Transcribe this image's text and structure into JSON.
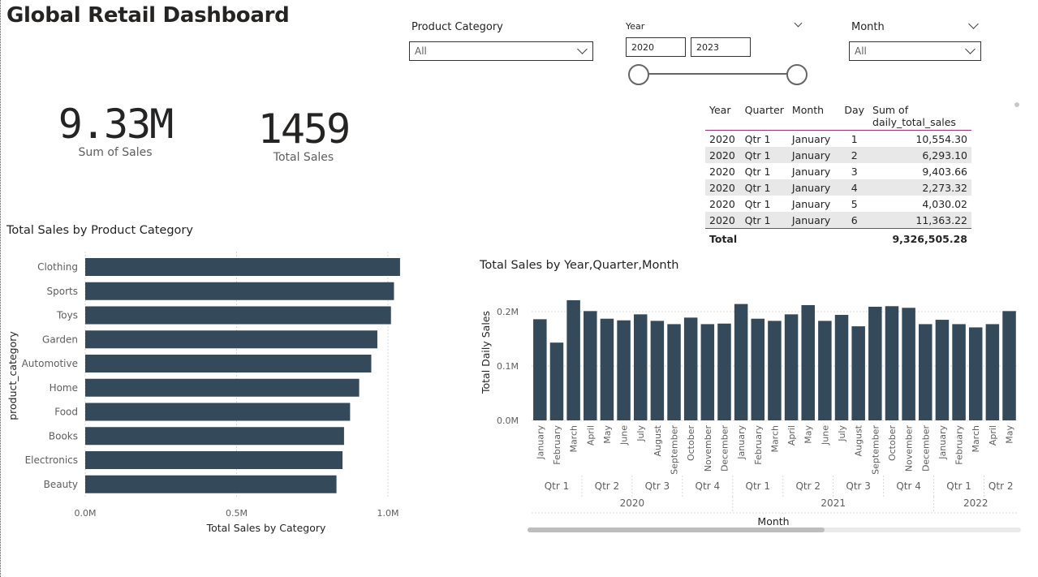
{
  "title": "Global Retail Dashboard",
  "slicers": {
    "product_category": {
      "label": "Product Category",
      "value": "All"
    },
    "year": {
      "label": "Year",
      "from": "2020",
      "to": "2023"
    },
    "month": {
      "label": "Month",
      "value": "All"
    }
  },
  "kpis": [
    {
      "value": "9.33M",
      "label": "Sum of Sales"
    },
    {
      "value": "1459",
      "label": "Total Sales"
    }
  ],
  "matrix": {
    "headers": [
      "Year",
      "Quarter",
      "Month",
      "Day",
      "Sum of daily_total_sales"
    ],
    "rows": [
      [
        "2020",
        "Qtr 1",
        "January",
        "1",
        "10,554.30"
      ],
      [
        "2020",
        "Qtr 1",
        "January",
        "2",
        "6,293.10"
      ],
      [
        "2020",
        "Qtr 1",
        "January",
        "3",
        "9,403.66"
      ],
      [
        "2020",
        "Qtr 1",
        "January",
        "4",
        "2,273.32"
      ],
      [
        "2020",
        "Qtr 1",
        "January",
        "5",
        "4,030.02"
      ],
      [
        "2020",
        "Qtr 1",
        "January",
        "6",
        "11,363.22"
      ]
    ],
    "total_label": "Total",
    "total_value": "9,326,505.28"
  },
  "colors": {
    "bar": "#34495a",
    "accent": "#a0326e",
    "grid": "#d9d9d9"
  },
  "chart_data": [
    {
      "type": "bar",
      "orientation": "horizontal",
      "title": "Total Sales by Product Category",
      "xlabel": "Total Sales by Category",
      "ylabel": "product_category",
      "categories": [
        "Clothing",
        "Sports",
        "Toys",
        "Garden",
        "Automotive",
        "Home",
        "Food",
        "Books",
        "Electronics",
        "Beauty"
      ],
      "values": [
        1.04,
        1.02,
        1.01,
        0.965,
        0.945,
        0.905,
        0.875,
        0.855,
        0.85,
        0.83
      ],
      "value_unit": "M",
      "xlim": [
        0,
        1.0
      ],
      "xticks": [
        "0.0M",
        "0.5M",
        "1.0M"
      ],
      "grid": true
    },
    {
      "type": "bar",
      "title": "Total Sales by Year,Quarter,Month",
      "xlabel": "Month",
      "ylabel": "Total Daily Sales",
      "categories": [
        "January",
        "February",
        "March",
        "April",
        "May",
        "June",
        "July",
        "August",
        "September",
        "October",
        "November",
        "December",
        "January",
        "February",
        "March",
        "April",
        "May",
        "June",
        "July",
        "August",
        "September",
        "October",
        "November",
        "December",
        "January",
        "February",
        "March",
        "April",
        "May"
      ],
      "values": [
        0.186,
        0.143,
        0.221,
        0.201,
        0.187,
        0.184,
        0.195,
        0.183,
        0.177,
        0.189,
        0.177,
        0.178,
        0.214,
        0.187,
        0.183,
        0.195,
        0.212,
        0.183,
        0.194,
        0.173,
        0.209,
        0.21,
        0.207,
        0.177,
        0.185,
        0.177,
        0.171,
        0.177,
        0.201
      ],
      "value_unit": "M",
      "quarters": [
        "Qtr 1",
        "Qtr 2",
        "Qtr 3",
        "Qtr 4",
        "Qtr 1",
        "Qtr 2",
        "Qtr 3",
        "Qtr 4",
        "Qtr 1",
        "Qtr 2"
      ],
      "years": [
        "2020",
        "2021",
        "2022"
      ],
      "ylim": [
        0,
        0.2
      ],
      "yticks": [
        "0.0M",
        "0.1M",
        "0.2M"
      ],
      "grid": true
    }
  ]
}
